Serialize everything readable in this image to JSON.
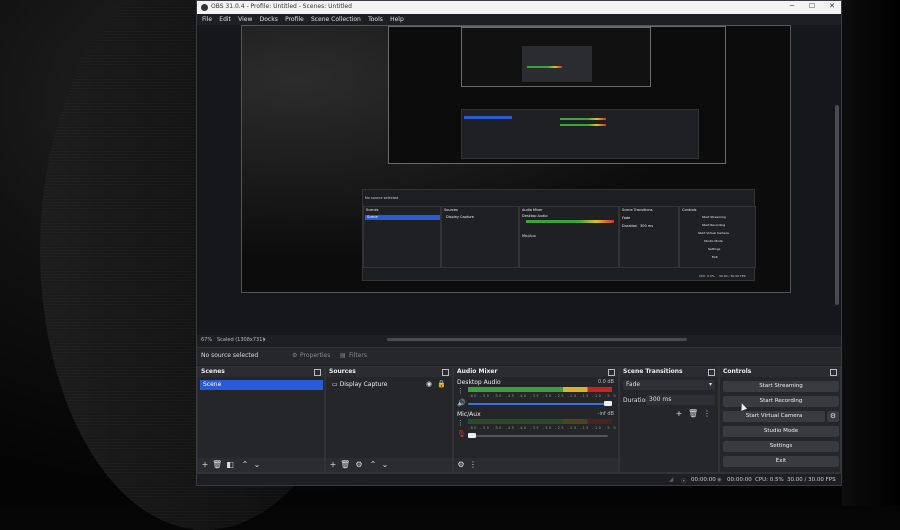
{
  "window": {
    "title": "OBS 31.0.4 - Profile: Untitled - Scenes: Untitled",
    "controls": {
      "minimize": "─",
      "maximize": "☐",
      "close": "✕"
    }
  },
  "menu": [
    "File",
    "Edit",
    "View",
    "Docks",
    "Profile",
    "Scene Collection",
    "Tools",
    "Help"
  ],
  "zoom": {
    "percent": "67%",
    "scale": "Scaled (1308x731)"
  },
  "context": {
    "no_source": "No source selected",
    "properties": "Properties",
    "filters": "Filters"
  },
  "scenes": {
    "title": "Scenes",
    "items": [
      "Scene"
    ]
  },
  "sources": {
    "title": "Sources",
    "items": [
      "Display Capture"
    ]
  },
  "mixer": {
    "title": "Audio Mixer",
    "tracks": [
      {
        "name": "Desktop Audio",
        "db": "0.0 dB",
        "level": 0.83
      },
      {
        "name": "Mic/Aux",
        "db": "-inf dB",
        "level": 0.0
      }
    ],
    "ticks": "-60 -55 -50 -45 -40 -35 -30 -25 -20 -15 -10 -5 0"
  },
  "transitions": {
    "title": "Scene Transitions",
    "selected": "Fade",
    "duration_label": "Duration",
    "duration_value": "300 ms"
  },
  "controls": {
    "title": "Controls",
    "start_streaming": "Start Streaming",
    "start_recording": "Start Recording",
    "start_virtual_camera": "Start Virtual Camera",
    "studio_mode": "Studio Mode",
    "settings": "Settings",
    "exit": "Exit"
  },
  "status": {
    "stream_time": "00:00:00",
    "rec_time": "00:00:00",
    "cpu": "CPU: 0.5%",
    "fps": "30.00 / 30.00 FPS"
  },
  "preview_nested": {
    "no_source": "No source selected",
    "scenes": "Scenes",
    "sources": "Sources",
    "mixer": "Audio Mixer",
    "transitions": "Scene Transitions",
    "controls": "Controls",
    "scene": "Scene",
    "source": "Display Capture",
    "desktop": "Desktop Audio",
    "mic": "Mic/Aux",
    "fade": "Fade",
    "duration": "Duration",
    "duration_value": "300 ms",
    "start_streaming": "Start Streaming",
    "start_recording": "Start Recording",
    "start_virtual_camera": "Start Virtual Camera",
    "studio_mode": "Studio Mode",
    "settings": "Settings",
    "exit": "Exit",
    "cpu": "CPU: 0.5%",
    "fps": "30.00 / 30.00 FPS"
  }
}
